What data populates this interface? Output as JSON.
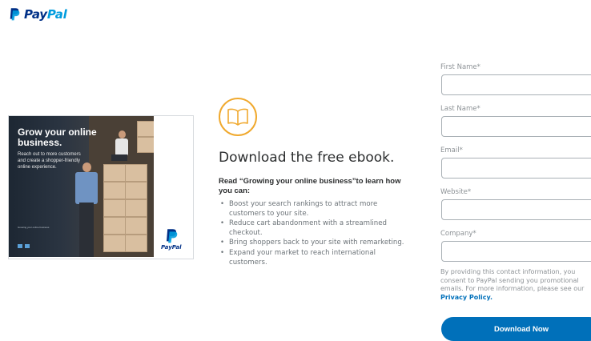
{
  "header": {
    "logo_part1": "Pay",
    "logo_part2": "Pal",
    "logo_icon": "paypal-p-icon"
  },
  "ebook_cover": {
    "title": "Grow your online business.",
    "subtitle": "Reach out to more customers and create a shopper-friendly online experience.",
    "fine_print": "Growing your online business",
    "logo_text": "PayPal"
  },
  "main": {
    "icon": "book-icon",
    "headline": "Download the free ebook.",
    "lead": "Read “Growing your online business”to learn how you can:",
    "bullets": [
      "Boost your search rankings to attract more customers to your site.",
      "Reduce cart abandonment with a streamlined checkout.",
      "Bring shoppers back to your site with remarketing.",
      "Expand your market to reach international customers."
    ]
  },
  "form": {
    "fields": [
      {
        "label": "First Name*",
        "value": ""
      },
      {
        "label": "Last Name*",
        "value": ""
      },
      {
        "label": "Email*",
        "value": ""
      },
      {
        "label": "Website*",
        "value": ""
      },
      {
        "label": "Company*",
        "value": ""
      }
    ],
    "consent_text": "By providing this contact information, you consent to PayPal sending you promotional emails. For more information, please see our",
    "privacy_link": "Privacy Policy.",
    "submit_label": "Download Now"
  },
  "colors": {
    "brand_dark": "#003087",
    "brand_light": "#009cde",
    "button": "#0070ba",
    "accent_icon": "#f0a92e"
  }
}
